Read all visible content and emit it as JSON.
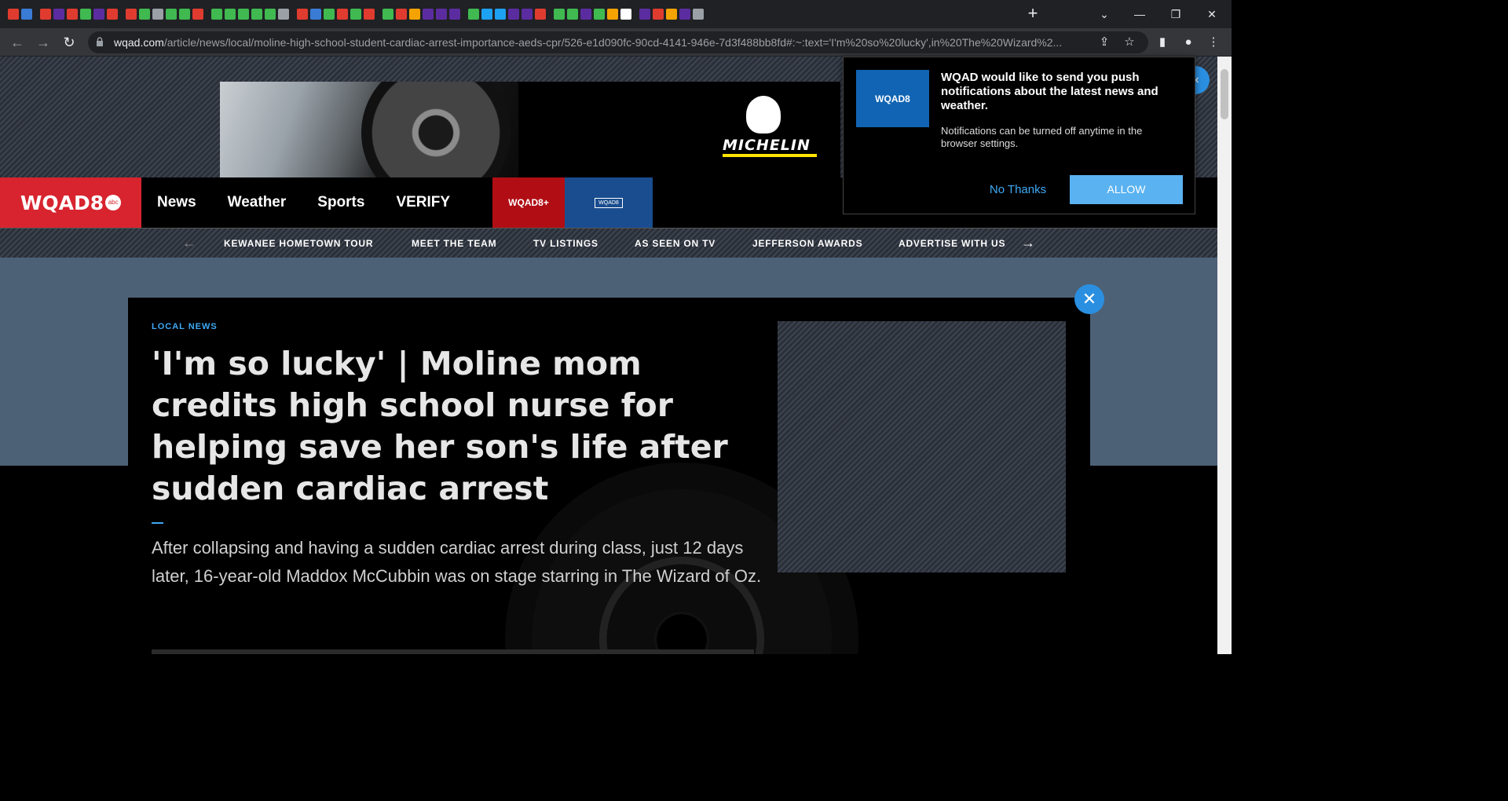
{
  "browser": {
    "new_tab": "+",
    "url_host": "wqad.com",
    "url_path": "/article/news/local/moline-high-school-student-cardiac-arrest-importance-aeds-cpr/526-e1d090fc-90cd-4141-946e-7d3f488bb8fd#:~:text='I'm%20so%20lucky',in%20The%20Wizard%2...",
    "tab_favicon_colors": [
      "#e03b2f",
      "#3a7bd5",
      "#e03b2f",
      "#5b2ca0",
      "#e03b2f",
      "#3fb950",
      "#5b2ca0",
      "#e03b2f",
      "#e03b2f",
      "#3fb950",
      "#9aa0a6",
      "#3fb950",
      "#3fb950",
      "#e03b2f",
      "#3fb950",
      "#3fb950",
      "#3fb950",
      "#3fb950",
      "#3fb950",
      "#9aa0a6",
      "#e03b2f",
      "#3a7bd5",
      "#3fb950",
      "#e03b2f",
      "#3fb950",
      "#e03b2f",
      "#3fb950",
      "#e03b2f",
      "#f4a300",
      "#5b2ca0",
      "#5b2ca0",
      "#5b2ca0",
      "#3fb950",
      "#1da1f2",
      "#1da1f2",
      "#5b2ca0",
      "#5b2ca0",
      "#e03b2f",
      "#3fb950",
      "#3fb950",
      "#5b2ca0",
      "#3fb950",
      "#f4a300",
      "#ffffff",
      "#5b2ca0",
      "#e03b2f",
      "#f4a300",
      "#5b2ca0",
      "#9aa0a6"
    ]
  },
  "ad": {
    "brand": "MICHELIN"
  },
  "nav": {
    "logo": "WQAD8",
    "logo_badge": "abc",
    "links": [
      "News",
      "Weather",
      "Sports",
      "VERIFY"
    ],
    "plus_label": "WQAD8+",
    "live_label": "WQAD8"
  },
  "subnav": {
    "prev": "←",
    "next": "→",
    "items": [
      "KEWANEE HOMETOWN TOUR",
      "MEET THE TEAM",
      "TV LISTINGS",
      "AS SEEN ON TV",
      "JEFFERSON AWARDS",
      "ADVERTISE WITH US"
    ]
  },
  "article": {
    "kicker": "LOCAL NEWS",
    "headline": "'I'm so lucky' | Moline mom credits high school nurse for helping save her son's life after sudden cardiac arrest",
    "summary": "After collapsing and having a sudden cardiac arrest during class, just 12 days later, 16-year-old Maddox McCubbin was on stage starring in The Wizard of Oz."
  },
  "popup": {
    "logo": "WQAD8",
    "title": "WQAD would like to send you push notifications about the latest news and weather.",
    "body": "Notifications can be turned off anytime in the browser settings.",
    "no_label": "No Thanks",
    "allow_label": "ALLOW"
  }
}
